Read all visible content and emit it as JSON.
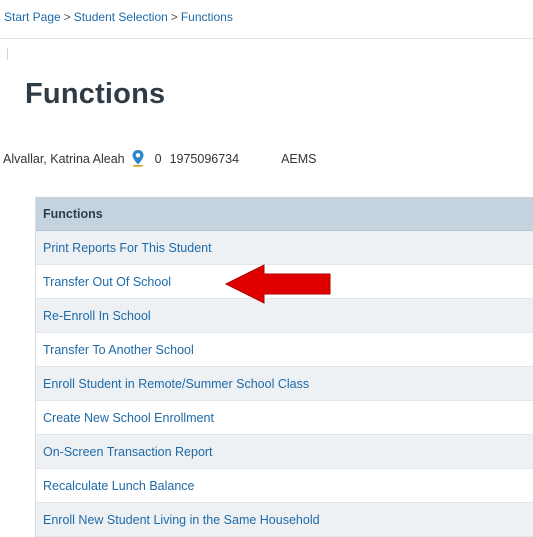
{
  "breadcrumb": {
    "items": [
      "Start Page",
      "Student Selection"
    ],
    "separator": ">",
    "current": "Functions"
  },
  "page": {
    "title": "Functions"
  },
  "student": {
    "name": "Alvallar, Katrina Aleah",
    "number": "0",
    "id": "1975096734",
    "school": "AEMS",
    "icon": "map-pin-icon"
  },
  "functions": {
    "header": "Functions",
    "items": [
      "Print Reports For This Student",
      "Transfer Out Of School",
      "Re-Enroll In School",
      "Transfer To Another School",
      "Enroll Student in Remote/Summer School Class",
      "Create New School Enrollment",
      "On-Screen Transaction Report",
      "Recalculate Lunch Balance",
      "Enroll New Student Living in the Same Household"
    ]
  },
  "annotation": {
    "icon": "red-arrow-icon",
    "color": "#e00000",
    "points_to": "Transfer Out Of School"
  },
  "colors": {
    "link": "#1e6aa8",
    "header_bg": "#c5d3de",
    "row_alt_bg": "#eef1f4",
    "title": "#2f3b45"
  }
}
